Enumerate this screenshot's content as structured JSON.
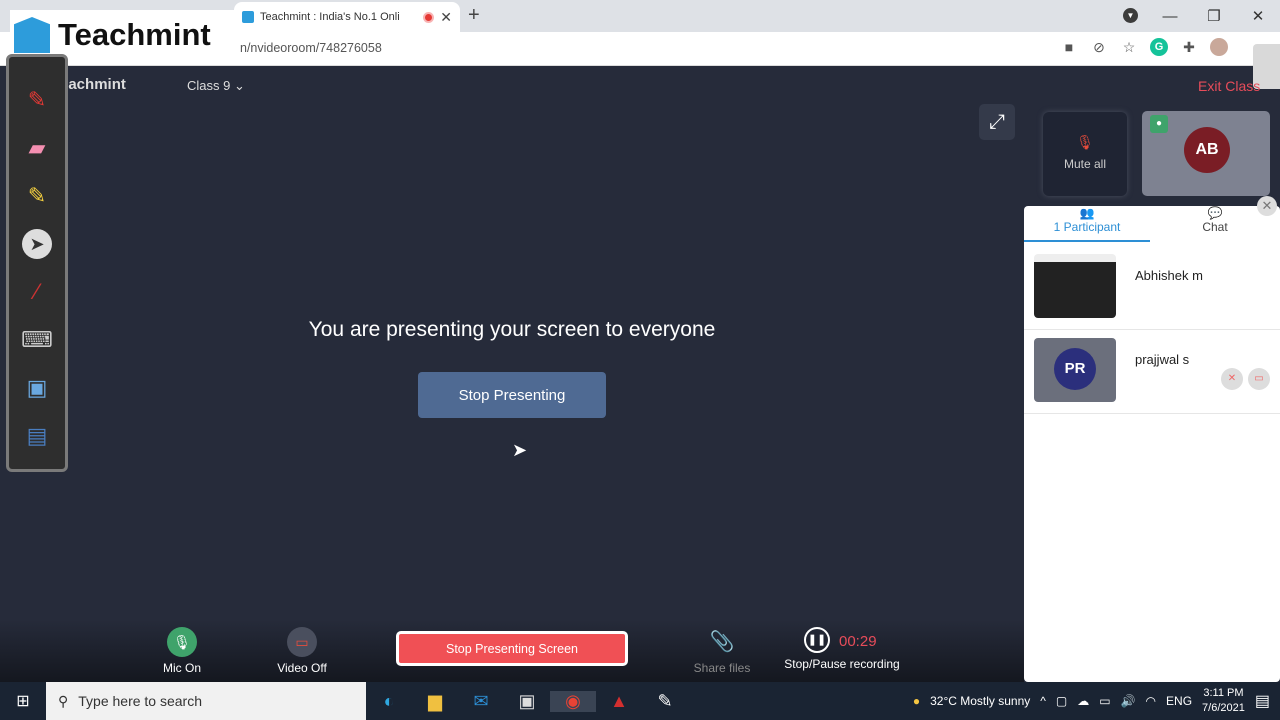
{
  "browser": {
    "tab_title": "Teachmint : India's No.1 Onli",
    "url": "n/nvideoroom/748276058",
    "new_tab": "+",
    "window_controls": [
      "—",
      "❐",
      "✕"
    ],
    "toolbar_icons": [
      "camera-icon",
      "eye-off-icon",
      "star-icon",
      "grammarly-icon",
      "extensions-icon",
      "profile-avatar"
    ]
  },
  "logo_overlay": {
    "brand": "Teachmint"
  },
  "app": {
    "brand": "eachmint",
    "class_select": "Class 9",
    "exit_label": "Exit Class"
  },
  "whiteboard_tools": [
    "pen-icon",
    "eraser-icon",
    "highlighter-icon",
    "pointer-icon",
    "laser-icon",
    "keyboard-icon",
    "screen-capture-icon",
    "screen-switch-icon"
  ],
  "main": {
    "message": "You are presenting your screen to everyone",
    "stop_button": "Stop Presenting"
  },
  "tiles": {
    "mute_all": "Mute all",
    "self_initials": "AB"
  },
  "panel": {
    "tab_participants": "1 Participant",
    "tab_chat": "Chat",
    "participants": [
      {
        "name": "Abhishek m",
        "type": "screen"
      },
      {
        "name": "prajjwal s",
        "initials": "PR",
        "mic": "off",
        "video": "off"
      }
    ]
  },
  "bottom": {
    "mic_label": "Mic On",
    "video_label": "Video Off",
    "stop_screen": "Stop Presenting Screen",
    "share_files": "Share files",
    "record_label": "Stop/Pause recording",
    "timer": "00:29"
  },
  "taskbar": {
    "search_placeholder": "Type here to search",
    "weather": "32°C  Mostly sunny",
    "lang": "ENG",
    "time": "3:11 PM",
    "date": "7/6/2021"
  }
}
